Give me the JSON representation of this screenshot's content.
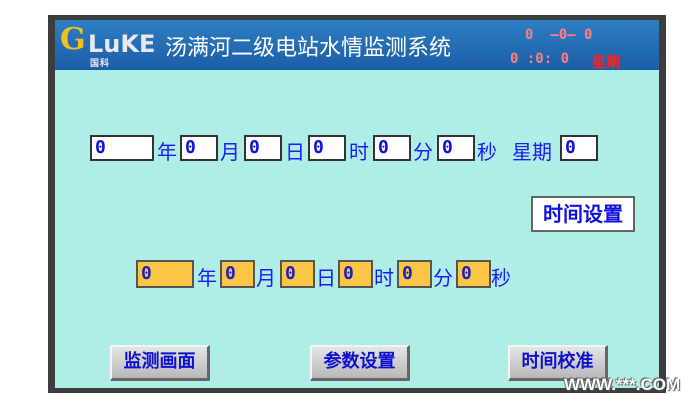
{
  "header": {
    "logo_text_g": "G",
    "logo_text_le": "LuKE",
    "logo_cn": "国科",
    "title": "汤满河二级电站水情监测系统",
    "date_display": "0  —0— 0",
    "time_display": "0 :0: 0",
    "weekday_label": "星期"
  },
  "set_row": {
    "year": "0",
    "year_label": "年",
    "month": "0",
    "month_label": "月",
    "day": "0",
    "day_label": "日",
    "hour": "0",
    "hour_label": "时",
    "minute": "0",
    "minute_label": "分",
    "second": "0",
    "second_label": "秒",
    "weekday_label": "星期",
    "weekday": "0"
  },
  "set_button": "时间设置",
  "current_row": {
    "year": "0",
    "year_label": "年",
    "month": "0",
    "month_label": "月",
    "day": "0",
    "day_label": "日",
    "hour": "0",
    "hour_label": "时",
    "minute": "0",
    "minute_label": "分",
    "second": "0",
    "second_label": "秒"
  },
  "nav": {
    "monitor": "监测画面",
    "params": "参数设置",
    "calibrate": "时间校准"
  },
  "watermark": "WWW.***.COM",
  "colors": {
    "header_blue": "#1f68b0",
    "screen_bg": "#aeeee6",
    "accent_yellow": "#fbc644",
    "label_blue": "#1a1aff"
  }
}
